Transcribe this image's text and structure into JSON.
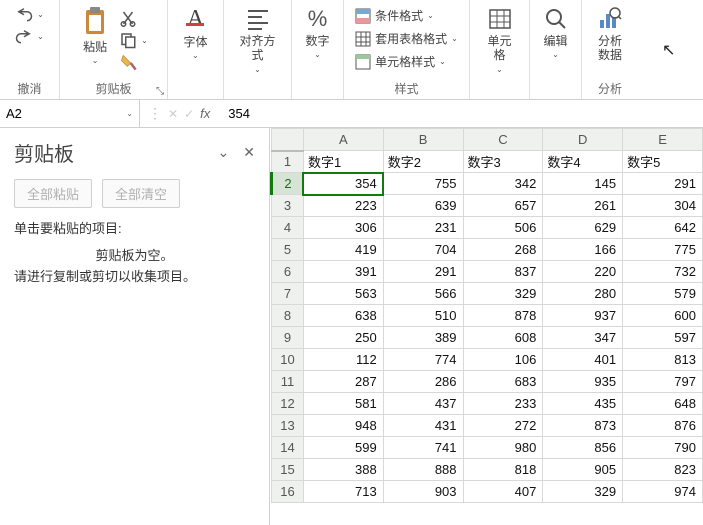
{
  "ribbon": {
    "undo_group": "撤消",
    "clipboard_group": "剪贴板",
    "paste": "粘贴",
    "font": "字体",
    "align": "对齐方式",
    "number": "数字",
    "styles_group": "样式",
    "cond_fmt": "条件格式",
    "table_fmt": "套用表格格式",
    "cell_style": "单元格样式",
    "cells": "单元格",
    "editing": "编辑",
    "analyze": "分析\n数据",
    "analyze_group": "分析"
  },
  "namebox": {
    "ref": "A2"
  },
  "formula": {
    "value": "354"
  },
  "clipboard_pane": {
    "title": "剪贴板",
    "paste_all": "全部粘贴",
    "clear_all": "全部清空",
    "instr": "单击要粘贴的项目:",
    "empty1": "剪贴板为空。",
    "empty2": "请进行复制或剪切以收集项目。"
  },
  "grid": {
    "columns": [
      "A",
      "B",
      "C",
      "D",
      "E"
    ],
    "header_row": [
      "数字1",
      "数字2",
      "数字3",
      "数字4",
      "数字5"
    ],
    "rows": [
      [
        354,
        755,
        342,
        145,
        291
      ],
      [
        223,
        639,
        657,
        261,
        304
      ],
      [
        306,
        231,
        506,
        629,
        642
      ],
      [
        419,
        704,
        268,
        166,
        775
      ],
      [
        391,
        291,
        837,
        220,
        732
      ],
      [
        563,
        566,
        329,
        280,
        579
      ],
      [
        638,
        510,
        878,
        937,
        600
      ],
      [
        250,
        389,
        608,
        347,
        597
      ],
      [
        112,
        774,
        106,
        401,
        813
      ],
      [
        287,
        286,
        683,
        935,
        797
      ],
      [
        581,
        437,
        233,
        435,
        648
      ],
      [
        948,
        431,
        272,
        873,
        876
      ],
      [
        599,
        741,
        980,
        856,
        790
      ],
      [
        388,
        888,
        818,
        905,
        823
      ],
      [
        713,
        903,
        407,
        329,
        974
      ]
    ],
    "active": {
      "row": 2,
      "col": "A"
    }
  },
  "icons": {
    "percent": "%",
    "chev": "⌄"
  }
}
